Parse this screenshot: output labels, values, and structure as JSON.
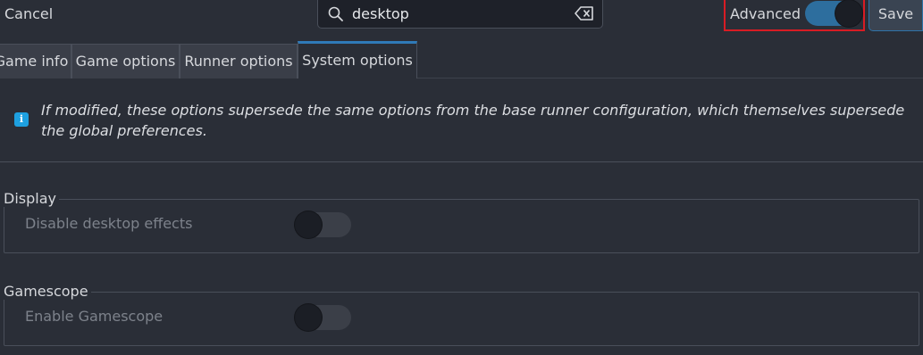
{
  "header": {
    "cancel_label": "Cancel",
    "search": {
      "value": "desktop",
      "icon": "search-icon",
      "clear_icon": "backspace-clear-icon"
    },
    "advanced": {
      "label": "Advanced",
      "enabled": true
    },
    "save_label": "Save"
  },
  "tabs": [
    {
      "label": "Game info",
      "active": false
    },
    {
      "label": "Game options",
      "active": false
    },
    {
      "label": "Runner options",
      "active": false
    },
    {
      "label": "System options",
      "active": true
    }
  ],
  "info": {
    "icon": "info-icon",
    "icon_glyph": "i",
    "text": "If modified, these options supersede the same options from the base runner configuration, which themselves supersede the global preferences."
  },
  "groups": [
    {
      "title": "Display",
      "option": {
        "label": "Disable desktop effects",
        "enabled": false
      }
    },
    {
      "title": "Gamescope",
      "option": {
        "label": "Enable Gamescope",
        "enabled": false
      }
    }
  ],
  "colors": {
    "background": "#2a2e37",
    "accent": "#2f7ab8",
    "highlight_border": "#d81c24",
    "info_icon": "#1ea0e0"
  }
}
